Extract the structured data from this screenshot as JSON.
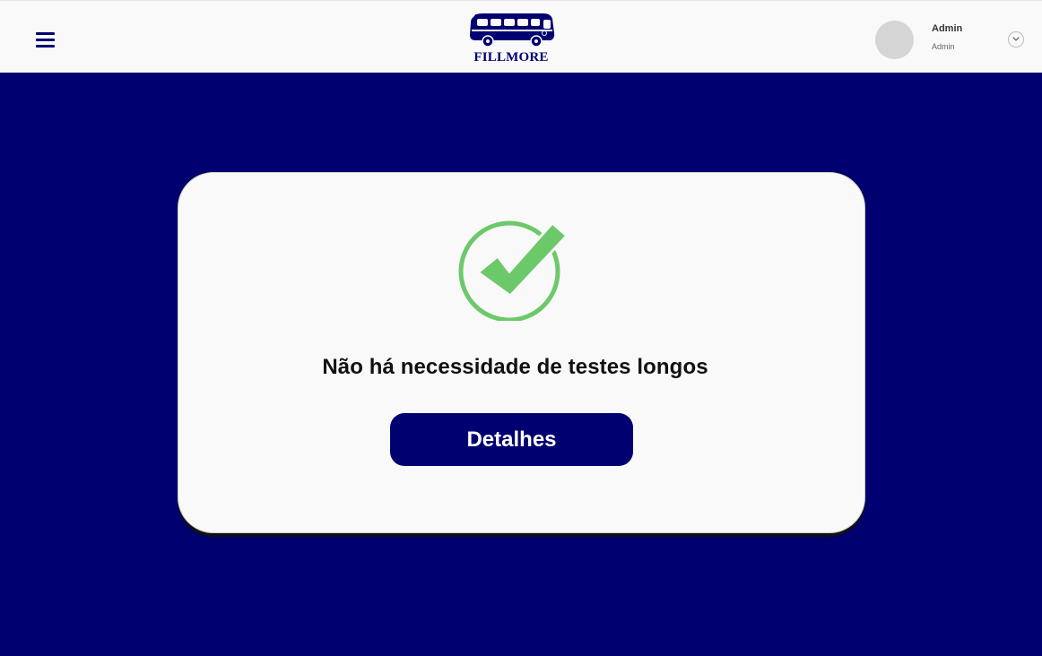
{
  "header": {
    "logo_text": "FILLMORE",
    "user": {
      "name": "Admin",
      "role": "Admin"
    }
  },
  "main": {
    "message": "Não há necessidade de testes longos",
    "details_label": "Detalhes"
  },
  "icons": {
    "menu": "hamburger-menu-icon",
    "logo": "bus-logo",
    "toggle": "chevron-down-icon",
    "status": "check-circle-icon"
  },
  "colors": {
    "brand": "#000070",
    "success": "#6cc96a",
    "background": "#f9f9f9"
  }
}
